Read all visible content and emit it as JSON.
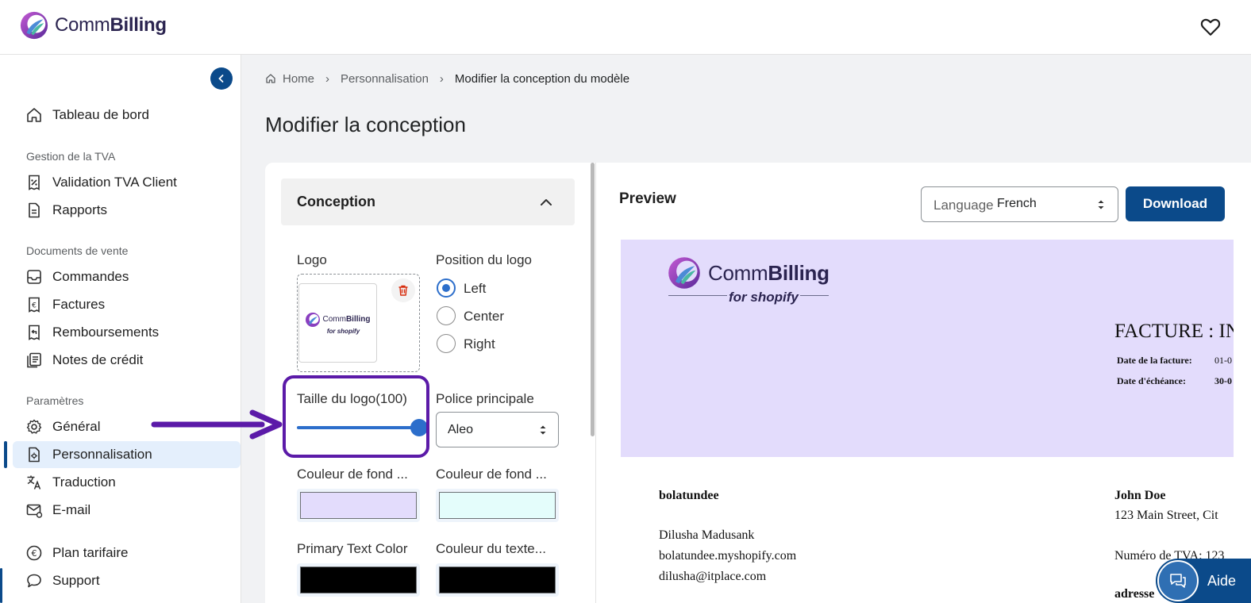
{
  "app": {
    "brand_light": "Comm",
    "brand_bold": "Billing"
  },
  "sidebar": {
    "items": [
      {
        "label": "Tableau de bord",
        "icon": "home-icon"
      },
      {
        "label": "Validation TVA Client",
        "icon": "receipt-percent-icon"
      },
      {
        "label": "Rapports",
        "icon": "document-icon"
      },
      {
        "label": "Commandes",
        "icon": "inbox-icon"
      },
      {
        "label": "Factures",
        "icon": "euro-receipt-icon"
      },
      {
        "label": "Remboursements",
        "icon": "refund-receipt-icon"
      },
      {
        "label": "Notes de crédit",
        "icon": "notes-icon"
      },
      {
        "label": "Général",
        "icon": "gear-icon"
      },
      {
        "label": "Personnalisation",
        "icon": "customize-icon",
        "active": true
      },
      {
        "label": "Traduction",
        "icon": "translate-icon"
      },
      {
        "label": "E-mail",
        "icon": "email-icon"
      },
      {
        "label": "Plan tarifaire",
        "icon": "euro-circle-icon"
      },
      {
        "label": "Support",
        "icon": "chat-icon"
      }
    ],
    "sections": {
      "vat": "Gestion de la TVA",
      "sales_docs": "Documents de vente",
      "settings": "Paramètres"
    }
  },
  "breadcrumb": {
    "home": "Home",
    "parent": "Personnalisation",
    "current": "Modifier la conception du modèle"
  },
  "page": {
    "title": "Modifier la conception"
  },
  "design": {
    "accordion_title": "Conception",
    "logo_label": "Logo",
    "logo_position_label": "Position du logo",
    "positions": [
      "Left",
      "Center",
      "Right"
    ],
    "selected_position": "Left",
    "logo_size_label": "Taille du logo(100)",
    "logo_size_value": 100,
    "font_label": "Police principale",
    "font_value": "Aleo",
    "bg_color_1_label": "Couleur de fond ...",
    "bg_color_2_label": "Couleur de fond ...",
    "bg_color_1": "#e3dcfc",
    "bg_color_2": "#e4fdfb",
    "primary_text_label": "Primary Text Color",
    "secondary_text_label": "Couleur du texte...",
    "primary_text_color": "#000000",
    "secondary_text_color": "#000000"
  },
  "preview": {
    "title": "Preview",
    "language_label": "Language",
    "language_value": "French",
    "download_label": "Download"
  },
  "invoice": {
    "logo_sub": "for shopify",
    "title": "FACTURE : IN",
    "invoice_date_label": "Date de la facture:",
    "invoice_date_value": "01-0",
    "due_date_label": "Date d'échéance:",
    "due_date_value": "30-0",
    "seller_name": "bolatundee",
    "seller_contact": "Dilusha Madusank",
    "seller_domain": "bolatundee.myshopify.com",
    "seller_email": "dilusha@itplace.com",
    "buyer_name": "John Doe",
    "buyer_address": "123 Main Street, Cit",
    "buyer_vat": "Numéro de TVA: 123",
    "buyer_address_label": "adresse"
  },
  "help": {
    "label": "Aide"
  },
  "colors": {
    "accent": "#0b4a8a",
    "control_blue": "#2c6ecb",
    "annotation": "#5b1aa8"
  }
}
